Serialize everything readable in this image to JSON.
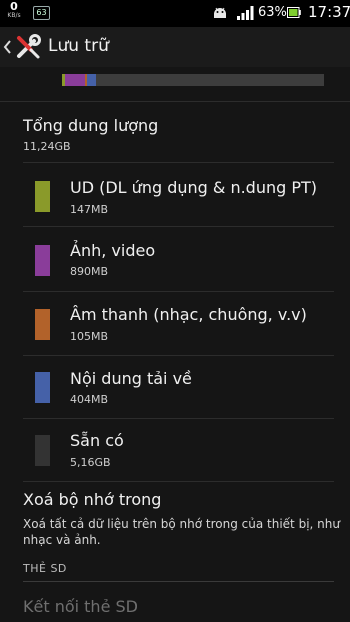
{
  "status_bar": {
    "net_speed_value": "0",
    "net_speed_unit": "KB/s",
    "debug_badge": "63",
    "battery_percent": "63%",
    "time": "17:37",
    "icons": [
      "android-debug-icon",
      "signal-icon",
      "battery-icon"
    ]
  },
  "action_bar": {
    "title": "Lưu trữ",
    "icon": "tools-icon",
    "back": "chevron-left-icon"
  },
  "usage_bar": {
    "segments": [
      {
        "name": "app",
        "color": "#8a9a2a",
        "fraction": 0.013
      },
      {
        "name": "photo-video",
        "color": "#8a3d9a",
        "fraction": 0.077
      },
      {
        "name": "audio",
        "color": "#b2622a",
        "fraction": 0.009
      },
      {
        "name": "downloads",
        "color": "#4561a8",
        "fraction": 0.035
      }
    ]
  },
  "total": {
    "title": "Tổng dung lượng",
    "value": "11,24GB"
  },
  "categories": [
    {
      "label": "UD (DL ứng dụng & n.dung PT)",
      "size": "147MB",
      "color": "#8a9a2a"
    },
    {
      "label": "Ảnh, video",
      "size": "890MB",
      "color": "#8a3d9a"
    },
    {
      "label": "Âm thanh (nhạc, chuông, v.v)",
      "size": "105MB",
      "color": "#b2622a"
    },
    {
      "label": "Nội dung tải về",
      "size": "404MB",
      "color": "#4561a8"
    },
    {
      "label": "Sẵn có",
      "size": "5,16GB",
      "color": "#333333"
    }
  ],
  "erase": {
    "title": "Xoá bộ nhớ trong",
    "description": "Xoá tất cả dữ liệu trên bộ nhớ trong của thiết bị, như nhạc và ảnh."
  },
  "sd_section": {
    "header": "THẺ SD",
    "mount_label": "Kết nối thẻ SD"
  }
}
